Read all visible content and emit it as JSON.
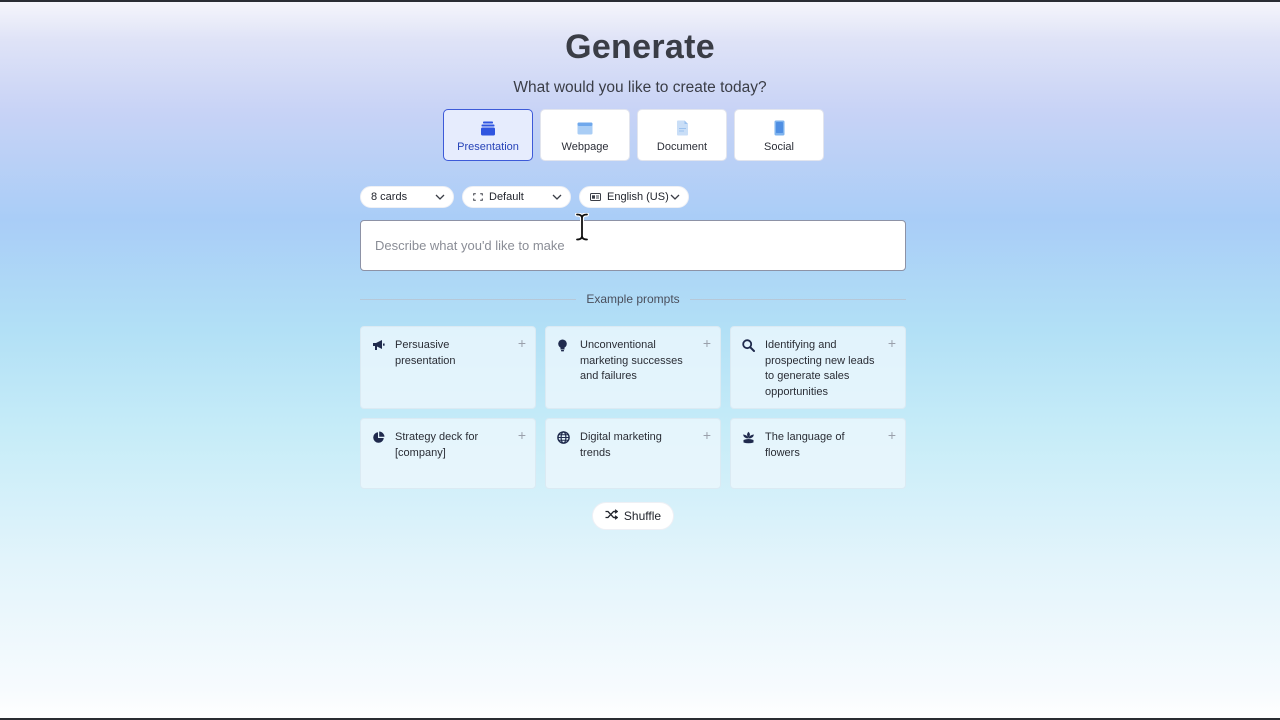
{
  "header": {
    "title": "Generate",
    "subtitle": "What would you like to create today?"
  },
  "types": [
    {
      "label": "Presentation",
      "icon": "presentation-icon",
      "active": true
    },
    {
      "label": "Webpage",
      "icon": "webpage-icon",
      "active": false
    },
    {
      "label": "Document",
      "icon": "document-icon",
      "active": false
    },
    {
      "label": "Social",
      "icon": "social-icon",
      "active": false
    }
  ],
  "controls": {
    "cards_label": "8 cards",
    "theme_label": "Default",
    "language_label": "English (US)"
  },
  "prompt": {
    "placeholder": "Describe what you'd like to make",
    "value": ""
  },
  "examples": {
    "heading": "Example prompts",
    "items": [
      {
        "text": "Persuasive presentation",
        "icon": "megaphone-icon"
      },
      {
        "text": "Unconventional marketing successes and failures",
        "icon": "lightbulb-icon"
      },
      {
        "text": "Identifying and prospecting new leads to generate sales opportunities",
        "icon": "search-icon"
      },
      {
        "text": "Strategy deck for [company]",
        "icon": "pie-chart-icon"
      },
      {
        "text": "Digital marketing trends",
        "icon": "globe-icon"
      },
      {
        "text": "The language of flowers",
        "icon": "flower-icon"
      }
    ],
    "add_symbol": "+"
  },
  "shuffle_label": "Shuffle",
  "colors": {
    "accent": "#3d5ad8",
    "active_bg": "#e6ecfd",
    "icon_dark": "#1f2a4d"
  }
}
